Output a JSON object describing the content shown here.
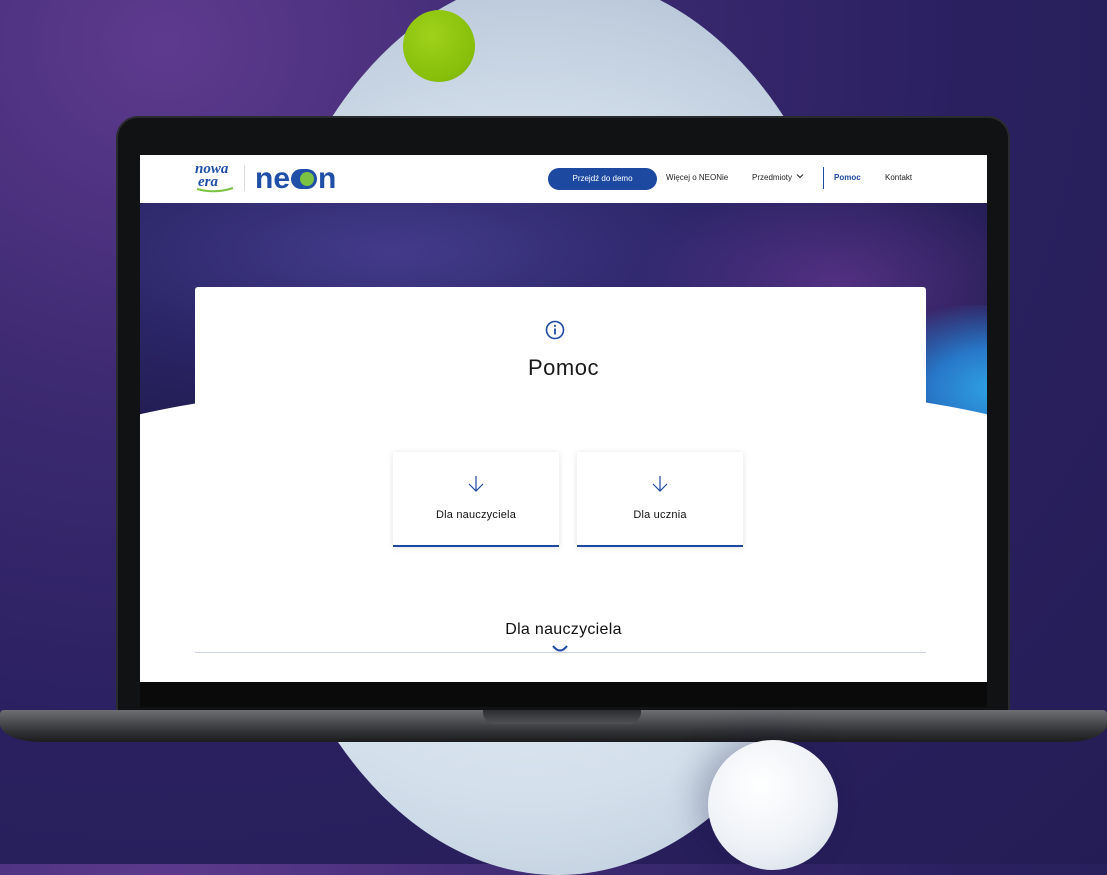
{
  "nav": {
    "logo_nowa_line1": "nowa",
    "logo_nowa_line2": "era",
    "logo_neon_start": "ne",
    "logo_neon_end": "n",
    "demo_button": "Przejdź do demo",
    "links": [
      "Więcej o NEONie",
      "Przedmioty",
      "Pomoc",
      "Kontakt"
    ],
    "active": "Pomoc"
  },
  "main": {
    "title": "Pomoc",
    "choices": [
      "Dla nauczyciela",
      "Dla ucznia"
    ],
    "section_title": "Dla nauczyciela"
  },
  "colors": {
    "brand_blue": "#1d4aa0",
    "accent_green": "#7cc242",
    "background_purple": "#2a2060"
  },
  "icons": [
    "info-icon",
    "arrow-down-icon",
    "chevron-down-icon"
  ]
}
